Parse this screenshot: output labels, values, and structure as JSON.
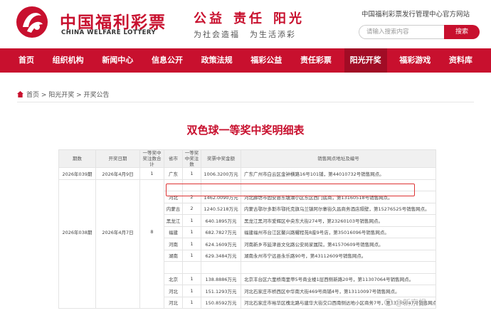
{
  "brand": {
    "name_cn": "中国福利彩票",
    "name_en": "CHINA WELFARE LOTTERY",
    "slogan_top": [
      "公益",
      "责任",
      "阳光"
    ],
    "slogan_bottom": [
      "为社会造福",
      "为生活添彩"
    ],
    "site_name": "中国福利彩票发行管理中心官方网站",
    "color_primary": "#c8102e"
  },
  "search": {
    "placeholder": "请输入搜索内容",
    "button": "搜索"
  },
  "nav": [
    "首页",
    "组织机构",
    "新闻中心",
    "信息公开",
    "政策法规",
    "福彩公益",
    "责任彩票",
    "阳光开奖",
    "福彩游戏",
    "资料库"
  ],
  "nav_active_index": 7,
  "breadcrumb": "首页 > 阳光开奖 > 开奖公告",
  "page_title": "双色球一等奖中奖明细表",
  "table": {
    "headers": [
      "期数",
      "开奖日期",
      "一等奖中奖注数合计",
      "省市",
      "一等奖中奖注数",
      "奖票中奖金额",
      "销售网点地址及编号"
    ],
    "rows": [
      {
        "period": "2026年039期",
        "date": "2026年4月9日",
        "total": "1",
        "province": "广东",
        "count": "1",
        "amount": "1006.3200万元",
        "address": "广东广州市白云区金钟横路16号101铺，第44010732号销售网点。"
      },
      {
        "period": "",
        "date": "",
        "total": "",
        "province": "",
        "count": "",
        "amount": "",
        "address": ""
      },
      {
        "period": "",
        "date": "",
        "total": "",
        "province": "河北",
        "count": "2",
        "amount": "1462.0090万元",
        "address": "河北廊坊市固安县东塘湖小区东区西门底商，第13160518号销售网点。"
      },
      {
        "period": "",
        "date": "",
        "total": "",
        "province": "内蒙古",
        "count": "2",
        "amount": "1240.5218万元",
        "address": "内蒙古鄂尔多斯市鄂托克旗乌兰镇阿尔寨街久昌商务酒店隔壁，第15276525号销售网点。"
      },
      {
        "period": "",
        "date": "",
        "total": "",
        "province": "黑龙江",
        "count": "1",
        "amount": "640.1895万元",
        "address": "黑龙江黑河市爱辉区中央东大街274号，第23260103号销售网点。"
      },
      {
        "period": "2026年038期",
        "date": "2026年4月7日",
        "total": "8",
        "province": "福建",
        "count": "1",
        "amount": "682.7827万元",
        "address": "福建福州市台江区鳌兴路耀程苑8座9号店，第35016096号销售网点。"
      },
      {
        "period": "",
        "date": "",
        "total": "",
        "province": "河南",
        "count": "1",
        "amount": "624.1609万元",
        "address": "河南新乡市延津县文化路公安局家属院，第41570609号销售网点。"
      },
      {
        "period": "",
        "date": "",
        "total": "",
        "province": "湖南",
        "count": "1",
        "amount": "629.3484万元",
        "address": "湖南永州市宁远县永乐路90号，第43112609号销售网点。"
      },
      {
        "period": "",
        "date": "",
        "total": "",
        "province": "",
        "count": "",
        "amount": "",
        "address": ""
      },
      {
        "period": "",
        "date": "",
        "total": "",
        "province": "北京",
        "count": "1",
        "amount": "138.8886万元",
        "address": "北京丰台区六里桥南里甲5号商业楼1层西侧新路20号，第11307064号销售网点。"
      },
      {
        "period": "",
        "date": "",
        "total": "",
        "province": "河北",
        "count": "1",
        "amount": "151.1293万元",
        "address": "河北石家庄市桥西区中华南大街469号商铺4号，第13110097号销售网点。"
      },
      {
        "period": "",
        "date": "",
        "total": "",
        "province": "河北",
        "count": "1",
        "amount": "150.8592万元",
        "address": "河北石家庄市裕华区槐北路与建华大街交口西南侧达地小区商务7号，第13155047号销售网点。"
      }
    ]
  },
  "watermark": "@新京报"
}
